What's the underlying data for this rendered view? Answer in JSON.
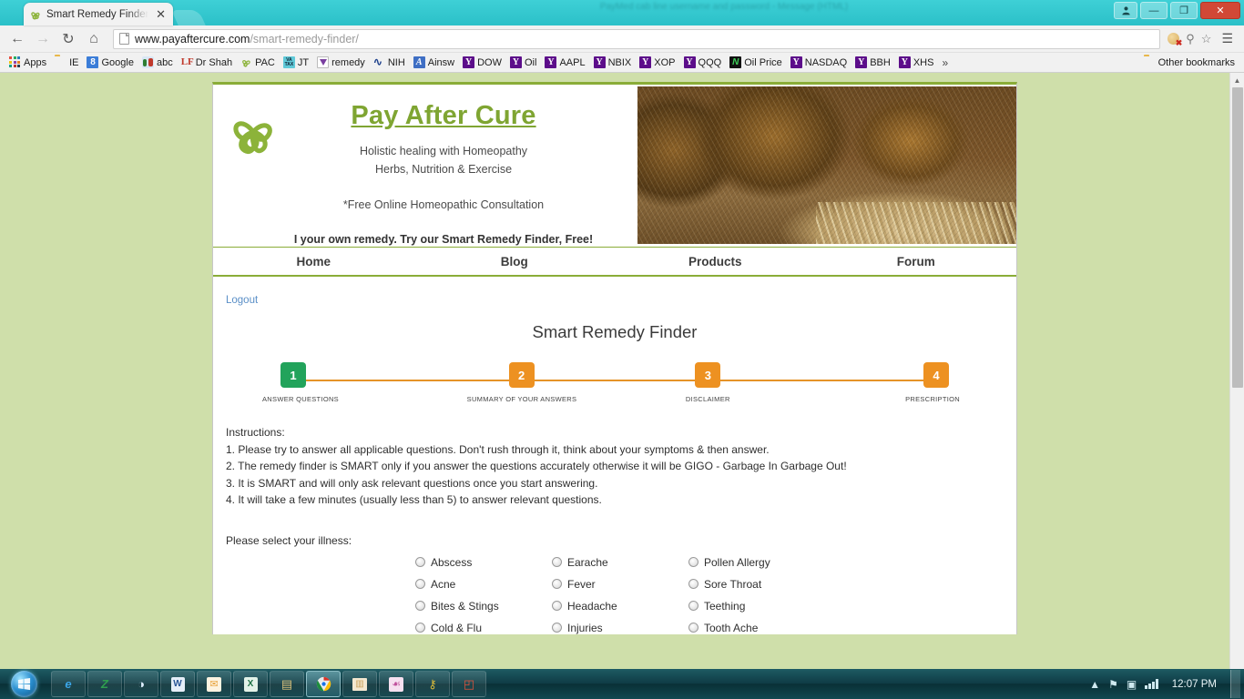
{
  "browser": {
    "tab": {
      "title": "Smart Remedy Finder | Pa",
      "close": "✕",
      "favicon": "flower-favicon"
    },
    "ghost_window_title": "PayMed cab line username and password - Message (HTML)",
    "window_controls": {
      "person": "●",
      "minimize": "—",
      "restore": "❐",
      "close": "✕"
    },
    "nav": {
      "back": "←",
      "forward": "→",
      "reload": "↻",
      "home": "⌂"
    },
    "omnibox": {
      "url_prefix": "www.payaftercure.com",
      "url_suffix": "/smart-remedy-finder/",
      "cookie_blocked_icon": "cookie-blocked-icon",
      "search_icon": "⚲",
      "star_icon": "☆",
      "menu_icon": "☰"
    },
    "bookmarks": [
      {
        "label": "Apps",
        "icon": "apps-grid-icon"
      },
      {
        "label": "IE",
        "icon": "folder-icon"
      },
      {
        "label": "Google",
        "icon": "google-icon"
      },
      {
        "label": "abc",
        "icon": "abc-icon"
      },
      {
        "label": "Dr Shah",
        "icon": "lf-icon"
      },
      {
        "label": "PAC",
        "icon": "flower-icon"
      },
      {
        "label": "JT",
        "icon": "vatax-icon"
      },
      {
        "label": "remedy",
        "icon": "remedy-icon"
      },
      {
        "label": "NIH",
        "icon": "nih-icon"
      },
      {
        "label": "Ainsw",
        "icon": "ainsworth-icon"
      },
      {
        "label": "DOW",
        "icon": "yahoo-icon"
      },
      {
        "label": "Oil",
        "icon": "yahoo-icon"
      },
      {
        "label": "AAPL",
        "icon": "yahoo-icon"
      },
      {
        "label": "NBIX",
        "icon": "yahoo-icon"
      },
      {
        "label": "XOP",
        "icon": "yahoo-icon"
      },
      {
        "label": "QQQ",
        "icon": "yahoo-icon"
      },
      {
        "label": "Oil Price",
        "icon": "oilprice-icon"
      },
      {
        "label": "NASDAQ",
        "icon": "yahoo-icon"
      },
      {
        "label": "BBH",
        "icon": "yahoo-icon"
      },
      {
        "label": "XHS",
        "icon": "yahoo-icon"
      }
    ],
    "bookmarks_overflow": "»",
    "other_bookmarks": {
      "label": "Other bookmarks",
      "icon": "folder-icon"
    }
  },
  "site": {
    "brand": "Pay After Cure",
    "tagline_line1": "Holistic healing with Homeopathy",
    "tagline_line2": "Herbs, Nutrition & Exercise",
    "free_consult": "*Free Online Homeopathic Consultation",
    "promo": "I your own remedy. Try our Smart Remedy Finder, Free!",
    "nav": [
      {
        "label": "Home"
      },
      {
        "label": "Blog"
      },
      {
        "label": "Products"
      },
      {
        "label": "Forum"
      }
    ],
    "logout": "Logout",
    "page_title": "Smart Remedy Finder",
    "colors": {
      "brand_green": "#7fa532",
      "step_active": "#22a35b",
      "step_inactive": "#ed9121",
      "page_bg": "#cfdfaa"
    },
    "steps": [
      {
        "number": "1",
        "label": "ANSWER QUESTIONS",
        "state": "active"
      },
      {
        "number": "2",
        "label": "SUMMARY OF YOUR ANSWERS",
        "state": "inactive"
      },
      {
        "number": "3",
        "label": "DISCLAIMER",
        "state": "inactive"
      },
      {
        "number": "4",
        "label": "PRESCRIPTION",
        "state": "inactive"
      }
    ],
    "instructions_heading": "Instructions:",
    "instructions": [
      "1. Please try to answer all applicable questions. Don't rush through it, think about your symptoms & then answer.",
      "2. The remedy finder is SMART only if you answer the questions accurately otherwise it will be GIGO - Garbage In Garbage Out!",
      "3. It is SMART and will only ask relevant questions once you start answering.",
      "4. It will take a few minutes (usually less than 5) to answer relevant questions."
    ],
    "illness_prompt": "Please select your illness:",
    "illness_options": [
      "Abscess",
      "Earache",
      "Pollen Allergy",
      "Acne",
      "Fever",
      "Sore Throat",
      "Bites & Stings",
      "Headache",
      "Teething",
      "Cold & Flu",
      "Injuries",
      "Tooth Ache"
    ]
  },
  "taskbar": {
    "start": "start-orb",
    "items": [
      {
        "name": "internet-explorer",
        "glyph": "e",
        "active": false
      },
      {
        "name": "z-app",
        "glyph": "Z",
        "active": false
      },
      {
        "name": "wifi-app",
        "glyph": "◑",
        "active": false
      },
      {
        "name": "word",
        "glyph": "W",
        "active": false
      },
      {
        "name": "mail-client",
        "glyph": "✉",
        "active": false
      },
      {
        "name": "excel",
        "glyph": "X",
        "active": false
      },
      {
        "name": "explorer",
        "glyph": "▤",
        "active": false
      },
      {
        "name": "chrome",
        "glyph": "◉",
        "active": true
      },
      {
        "name": "book-app",
        "glyph": "▥",
        "active": false
      },
      {
        "name": "paint-app",
        "glyph": "☙",
        "active": false
      },
      {
        "name": "key-app",
        "glyph": "⚷",
        "active": false
      },
      {
        "name": "photos-app",
        "glyph": "◰",
        "active": false
      }
    ],
    "tray": {
      "expand": "▲",
      "flag": "⚑",
      "action_center": "▣",
      "signal": "signal-bars"
    },
    "clock": "12:07 PM"
  }
}
